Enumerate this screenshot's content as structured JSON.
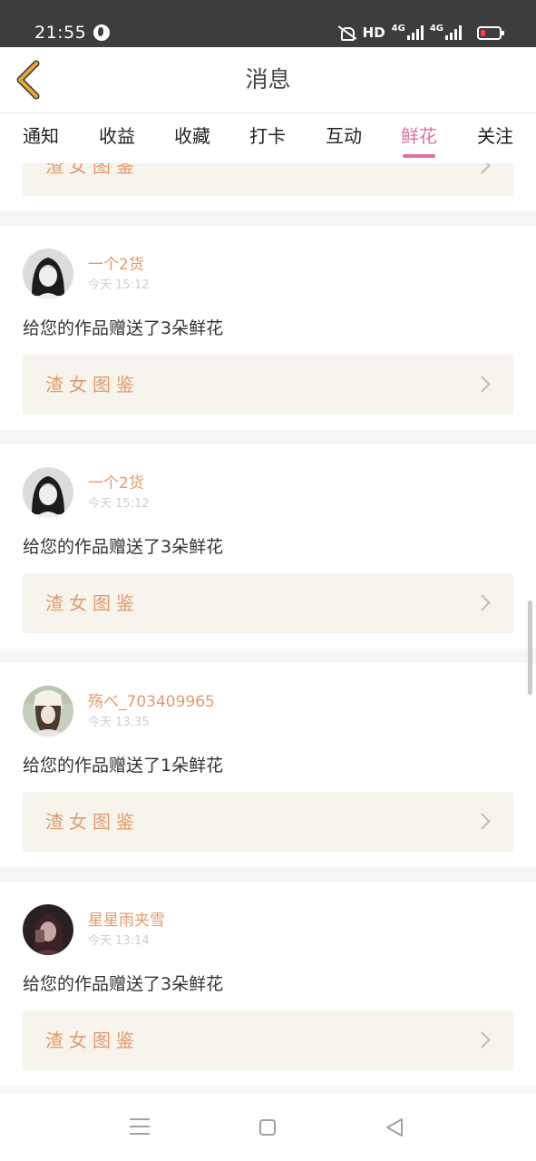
{
  "status_bar": {
    "time": "21:55",
    "hd": "HD",
    "net_primary": "4G",
    "net_secondary": "4G",
    "globe_icon": "globe-icon",
    "mute_icon": "bell-off-icon",
    "battery_color": "#ff3b3b"
  },
  "header": {
    "title": "消息",
    "back_icon": "chevron-left-icon",
    "back_color": "#e8a93a"
  },
  "tabs": [
    {
      "label": "通知",
      "active": false
    },
    {
      "label": "收益",
      "active": false
    },
    {
      "label": "收藏",
      "active": false
    },
    {
      "label": "打卡",
      "active": false
    },
    {
      "label": "互动",
      "active": false
    },
    {
      "label": "鲜花",
      "active": true
    },
    {
      "label": "关注",
      "active": false
    }
  ],
  "accent_color": "#e070a0",
  "name_color": "#e39a6d",
  "partial_card": {
    "work_title": "渣女图鉴"
  },
  "messages": [
    {
      "username": "一个2货",
      "time": "今天 15:12",
      "text": "给您的作品赠送了3朵鲜花",
      "work_title": "渣女图鉴"
    },
    {
      "username": "一个2货",
      "time": "今天 15:12",
      "text": "给您的作品赠送了3朵鲜花",
      "work_title": "渣女图鉴"
    },
    {
      "username": "殇べ_703409965",
      "time": "今天 13:35",
      "text": "给您的作品赠送了1朵鲜花",
      "work_title": "渣女图鉴"
    },
    {
      "username": "星星雨夹雪",
      "time": "今天 13:14",
      "text": "给您的作品赠送了3朵鲜花",
      "work_title": "渣女图鉴"
    }
  ],
  "nav_bar": {
    "menu_icon": "menu-icon",
    "home_icon": "square-icon",
    "back_icon": "triangle-back-icon"
  }
}
